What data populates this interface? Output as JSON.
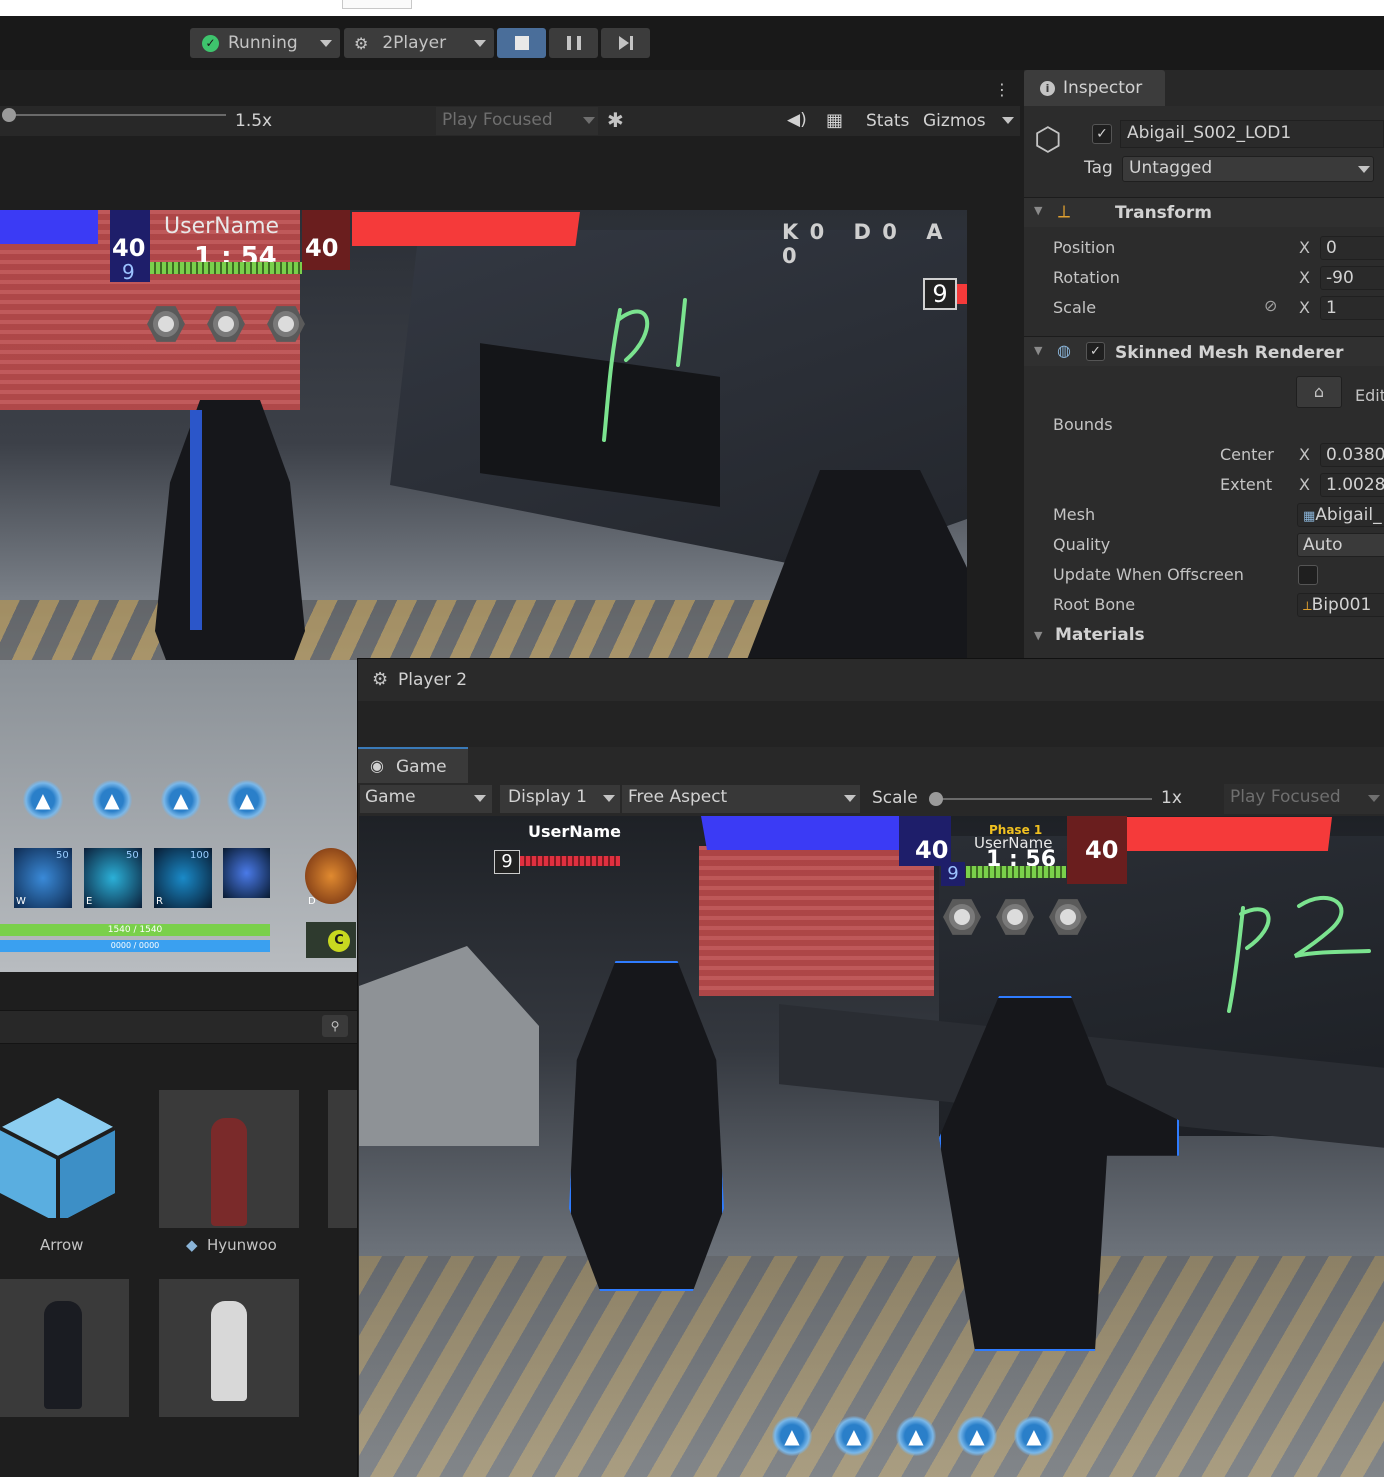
{
  "toolbar": {
    "status_label": "Running",
    "scenario_label": "2Player",
    "stop_icon": "stop-icon",
    "pause_icon": "pause-icon",
    "step_icon": "step-icon"
  },
  "game_view_1": {
    "zoom_label": "1.5x",
    "play_mode": "Play Focused",
    "stats_label": "Stats",
    "gizmos_label": "Gizmos",
    "hud": {
      "username": "UserName",
      "left_score": "40",
      "right_score": "40",
      "timer": "1 : 54",
      "level": "9",
      "kda": {
        "k_label": "K",
        "k": "0",
        "d_label": "D",
        "d": "0",
        "a_label": "A",
        "a": "0"
      },
      "enemy_level": "9",
      "hp_text": "1540 / 1540",
      "mp_text": "0000 / 0000",
      "skill_keys": [
        "W",
        "E",
        "R",
        "",
        "D"
      ],
      "skill_counts": [
        "50",
        "50",
        "100"
      ],
      "coin_label": "C"
    },
    "annotation": "p1"
  },
  "inspector": {
    "tab_label": "Inspector",
    "object_name": "Abigail_S002_LOD1",
    "tag_label": "Tag",
    "tag_value": "Untagged",
    "transform": {
      "title": "Transform",
      "position_label": "Position",
      "position_x": "0",
      "rotation_label": "Rotation",
      "rotation_x": "-90",
      "scale_label": "Scale",
      "scale_x": "1",
      "axis_x": "X"
    },
    "skinned": {
      "title": "Skinned Mesh Renderer",
      "edit_label": "Edit",
      "bounds_label": "Bounds",
      "center_label": "Center",
      "center_x": "0.0380",
      "extent_label": "Extent",
      "extent_x": "1.0028",
      "mesh_label": "Mesh",
      "mesh_value": "Abigail_",
      "quality_label": "Quality",
      "quality_value": "Auto",
      "update_label": "Update When Offscreen",
      "root_bone_label": "Root Bone",
      "root_bone_value": "Bip001",
      "materials_label": "Materials"
    }
  },
  "project": {
    "assets": [
      {
        "name": "Arrow"
      },
      {
        "name": "Hyunwoo"
      }
    ]
  },
  "player2": {
    "title": "Player 2",
    "tab_label": "Game",
    "game_dropdown": "Game",
    "display_dropdown": "Display 1",
    "aspect_dropdown": "Free Aspect",
    "scale_label": "Scale",
    "scale_value": "1x",
    "play_mode": "Play Focused",
    "hud": {
      "username_top": "UserName",
      "level": "9",
      "phase": "Phase 1",
      "username": "UserName",
      "left_score": "40",
      "right_score": "40",
      "timer": "1 : 56",
      "level2": "9"
    },
    "annotation": "p2"
  },
  "colors": {
    "blue_team": "#3b3bf5",
    "red_team": "#f53a3a",
    "accent_green": "#3ec46d",
    "annotation_green": "#7be38f"
  }
}
